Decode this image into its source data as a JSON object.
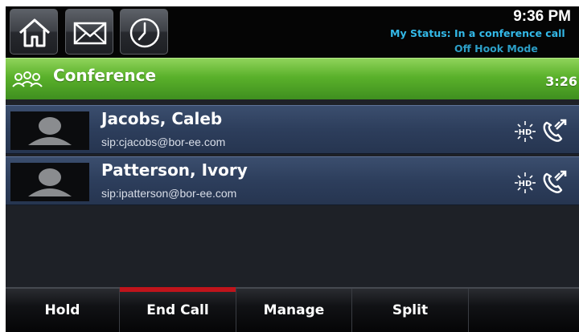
{
  "status_bar": {
    "time": "9:36 PM",
    "my_status": "My Status: In a conference call",
    "my_status_sub": "Off Hook Mode",
    "buttons": [
      {
        "icon": "home-icon"
      },
      {
        "icon": "mail-icon"
      },
      {
        "icon": "clock-icon"
      }
    ]
  },
  "conference": {
    "icon": "conference-people-icon",
    "title": "Conference",
    "timer": "3:26",
    "header_color": "#5ab12b"
  },
  "participants": [
    {
      "name": "Jacobs, Caleb",
      "sip": "sip:cjacobs@bor-ee.com",
      "hd": "HD",
      "call_icon": "call-active-icon"
    },
    {
      "name": "Patterson, Ivory",
      "sip": "sip:ipatterson@bor-ee.com",
      "hd": "HD",
      "call_icon": "call-active-icon"
    }
  ],
  "softkeys": [
    {
      "label": "Hold"
    },
    {
      "label": "End Call",
      "active": true,
      "accent": "#c0141b"
    },
    {
      "label": "Manage"
    },
    {
      "label": "Split"
    },
    {
      "label": ""
    }
  ]
}
